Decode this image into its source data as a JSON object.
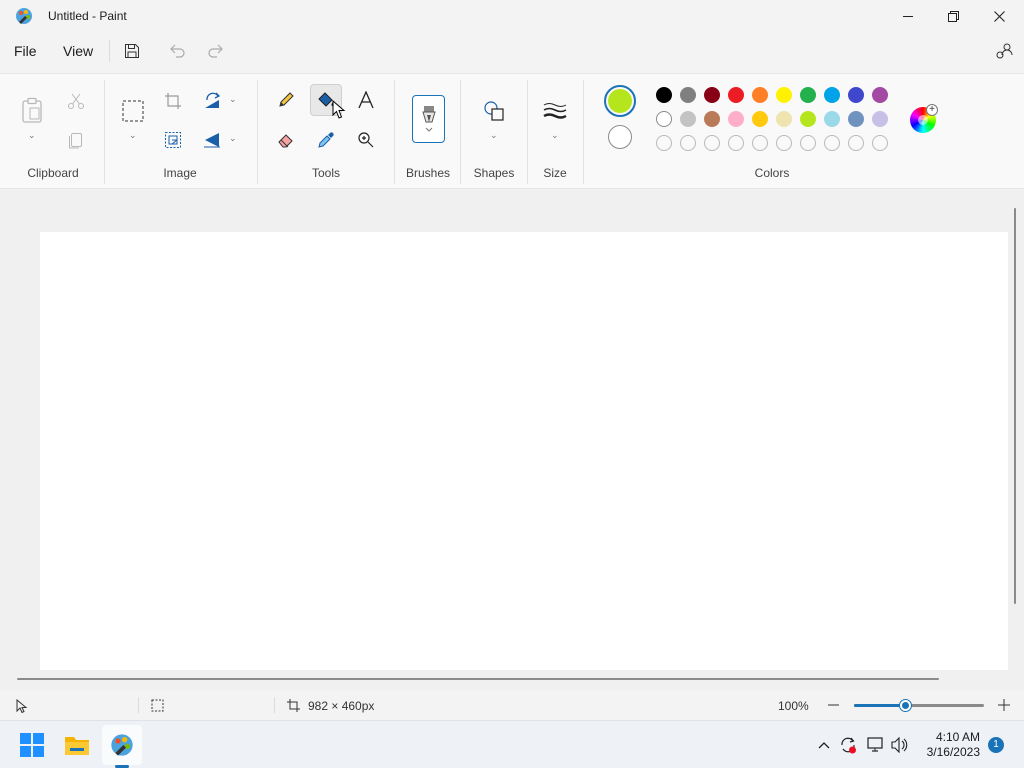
{
  "window": {
    "title": "Untitled - Paint",
    "controls": [
      "minimize-icon",
      "restore-icon",
      "close-icon"
    ]
  },
  "menu": {
    "file": "File",
    "view": "View",
    "save_icon": "save-icon",
    "undo_icon": "undo-icon",
    "redo_icon": "redo-icon",
    "account_icon": "settings-people-icon"
  },
  "ribbon": {
    "groups": {
      "clipboard": "Clipboard",
      "image": "Image",
      "tools": "Tools",
      "brushes": "Brushes",
      "shapes": "Shapes",
      "size": "Size",
      "colors": "Colors"
    },
    "active_tool": "fill-bucket"
  },
  "colors": {
    "primary": "#b5e61d",
    "secondary": "#ffffff",
    "palette_row1": [
      "#000000",
      "#7f7f7f",
      "#880015",
      "#ed1c24",
      "#ff7f27",
      "#fff200",
      "#22b14c",
      "#00a2e8",
      "#3f48cc",
      "#a349a4"
    ],
    "palette_row2": [
      "#ffffff",
      "#c3c3c3",
      "#b97a57",
      "#ffaec9",
      "#ffc90e",
      "#efe4b0",
      "#b5e61d",
      "#99d9ea",
      "#7092be",
      "#c8bfe7"
    ],
    "palette_row3_count": 10,
    "accent": "#1a73b7"
  },
  "status": {
    "canvas_size": "982 × 460px",
    "zoom": "100%",
    "zoom_level": 0.4
  },
  "taskbar": {
    "time": "4:10 AM",
    "date": "3/16/2023",
    "notifications": "1"
  }
}
